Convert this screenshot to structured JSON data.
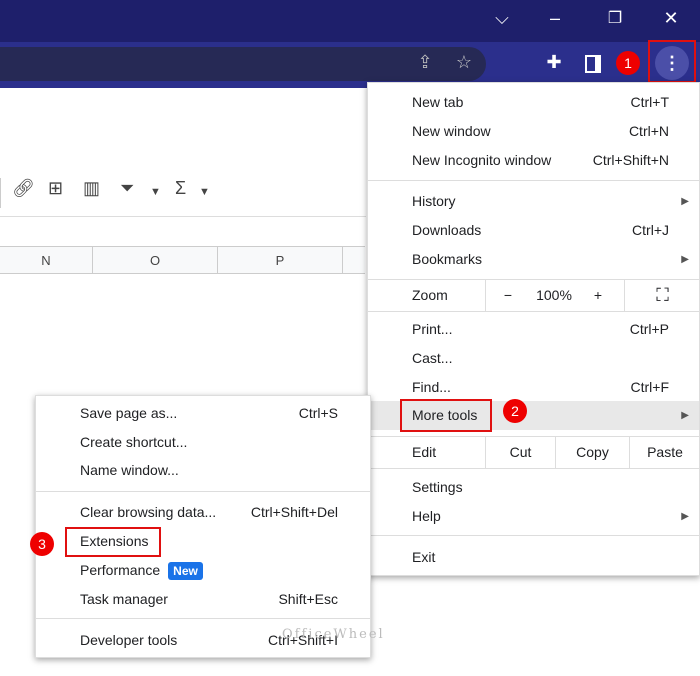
{
  "window_controls": {
    "tabsearch": "⌵",
    "minimize": "–",
    "restore": "❐",
    "close": "✕"
  },
  "sheet": {
    "columns": [
      "N",
      "O",
      "P"
    ]
  },
  "menu": {
    "items": [
      {
        "label": "New tab",
        "shortcut": "Ctrl+T"
      },
      {
        "label": "New window",
        "shortcut": "Ctrl+N"
      },
      {
        "label": "New Incognito window",
        "shortcut": "Ctrl+Shift+N"
      },
      {
        "label": "History"
      },
      {
        "label": "Downloads",
        "shortcut": "Ctrl+J"
      },
      {
        "label": "Bookmarks"
      },
      {
        "label": "Print...",
        "shortcut": "Ctrl+P"
      },
      {
        "label": "Cast..."
      },
      {
        "label": "Find...",
        "shortcut": "Ctrl+F"
      },
      {
        "label": "More tools"
      },
      {
        "label": "Settings"
      },
      {
        "label": "Help"
      },
      {
        "label": "Exit"
      }
    ],
    "zoom": {
      "label": "Zoom",
      "minus": "−",
      "value": "100%",
      "plus": "+"
    },
    "edit": {
      "label": "Edit",
      "cut": "Cut",
      "copy": "Copy",
      "paste": "Paste"
    }
  },
  "submenu": {
    "items": [
      {
        "label": "Save page as...",
        "shortcut": "Ctrl+S"
      },
      {
        "label": "Create shortcut..."
      },
      {
        "label": "Name window..."
      },
      {
        "label": "Clear browsing data...",
        "shortcut": "Ctrl+Shift+Del"
      },
      {
        "label": "Extensions"
      },
      {
        "label": "Performance",
        "badge": "New"
      },
      {
        "label": "Task manager",
        "shortcut": "Shift+Esc"
      },
      {
        "label": "Developer tools",
        "shortcut": "Ctrl+Shift+I"
      }
    ]
  },
  "steps": [
    "1",
    "2",
    "3"
  ],
  "watermark": "OfficeWheel"
}
